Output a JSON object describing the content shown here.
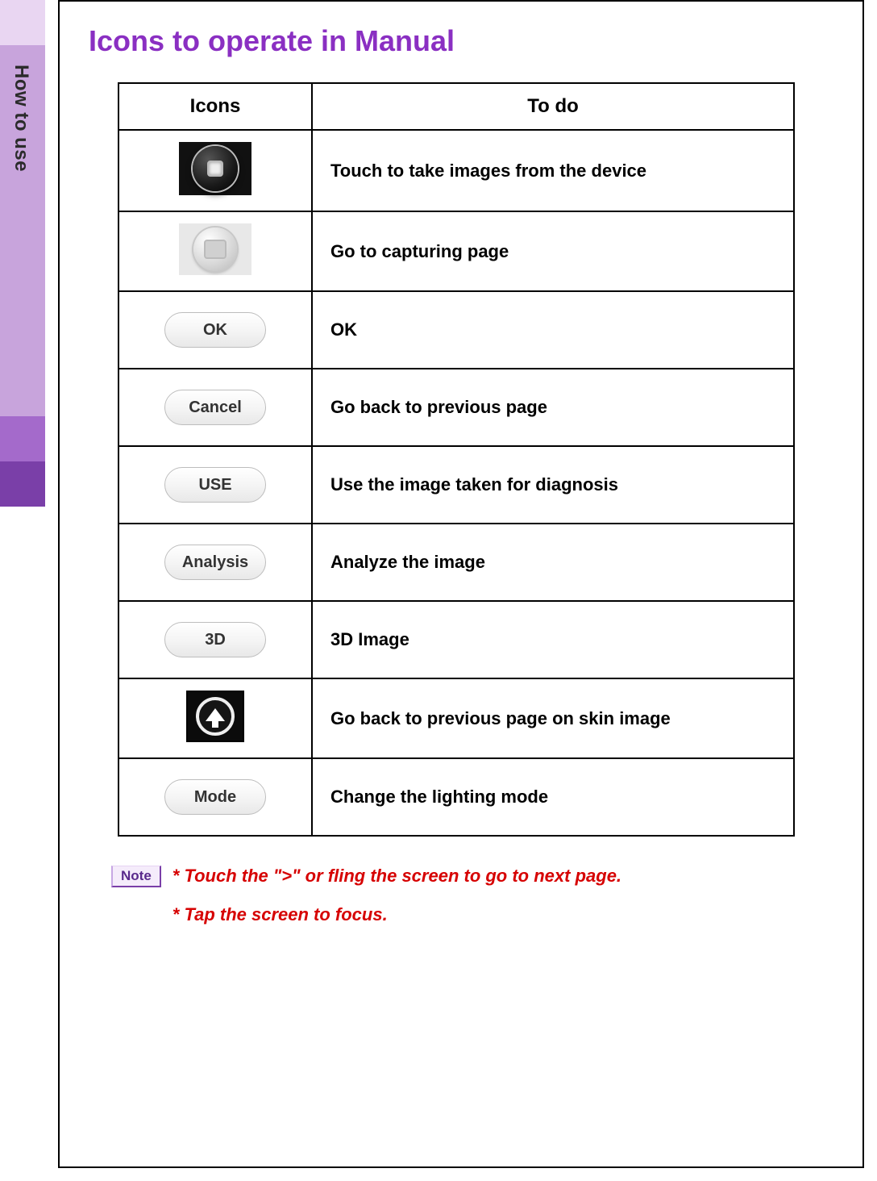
{
  "sidebar": {
    "label": "How to use"
  },
  "page": {
    "title": "Icons to operate in Manual"
  },
  "table": {
    "header_icons": "Icons",
    "header_todo": "To do",
    "rows": [
      {
        "icon_type": "capture",
        "label": "",
        "desc": "Touch to take images from the device"
      },
      {
        "icon_type": "goto",
        "label": "",
        "desc": "Go to capturing page"
      },
      {
        "icon_type": "pill",
        "label": "OK",
        "desc": "OK"
      },
      {
        "icon_type": "pill",
        "label": "Cancel",
        "desc": "Go back to previous page"
      },
      {
        "icon_type": "pill",
        "label": "USE",
        "desc": "Use the image taken for diagnosis"
      },
      {
        "icon_type": "pill",
        "label": "Analysis",
        "desc": "Analyze the image"
      },
      {
        "icon_type": "pill",
        "label": "3D",
        "desc": "3D Image"
      },
      {
        "icon_type": "up",
        "label": "",
        "desc": "Go back to previous page on skin image"
      },
      {
        "icon_type": "pill",
        "label": "Mode",
        "desc": "Change the lighting mode"
      }
    ]
  },
  "note": {
    "badge": "Note",
    "line1": "* Touch the \">\" or fling the screen to go to next page.",
    "line2": "* Tap the screen to focus."
  }
}
